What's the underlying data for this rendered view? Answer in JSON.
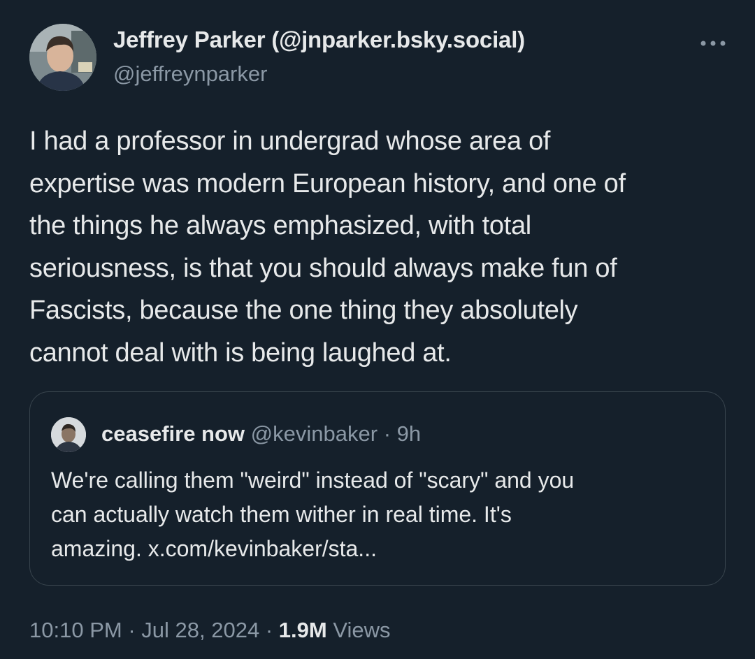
{
  "author": {
    "display_name": "Jeffrey Parker (@jnparker.bsky.social)",
    "handle": "@jeffreynparker"
  },
  "tweet": {
    "text": "I had a professor in undergrad whose area of\nexpertise was modern European history, and one of\nthe things he always emphasized, with total\nseriousness, is that you should always make fun of\nFascists, because the one thing they absolutely\ncannot deal with is being laughed at."
  },
  "quote": {
    "display_name": "ceasefire now",
    "handle": "@kevinbaker",
    "separator": "·",
    "age": "9h",
    "text": "We're calling them \"weird\" instead of \"scary\" and you\ncan actually watch them wither in real time. It's\namazing. x.com/kevinbaker/sta..."
  },
  "footer": {
    "time": "10:10 PM",
    "separator": "·",
    "date": "Jul 28, 2024",
    "views_count": "1.9M",
    "views_label": "Views"
  },
  "icons": {
    "more": "more-horizontal-icon"
  },
  "colors": {
    "background": "#15202b",
    "primary_text": "#e7e9ea",
    "secondary_text": "#8b98a5",
    "border": "#38444d"
  }
}
